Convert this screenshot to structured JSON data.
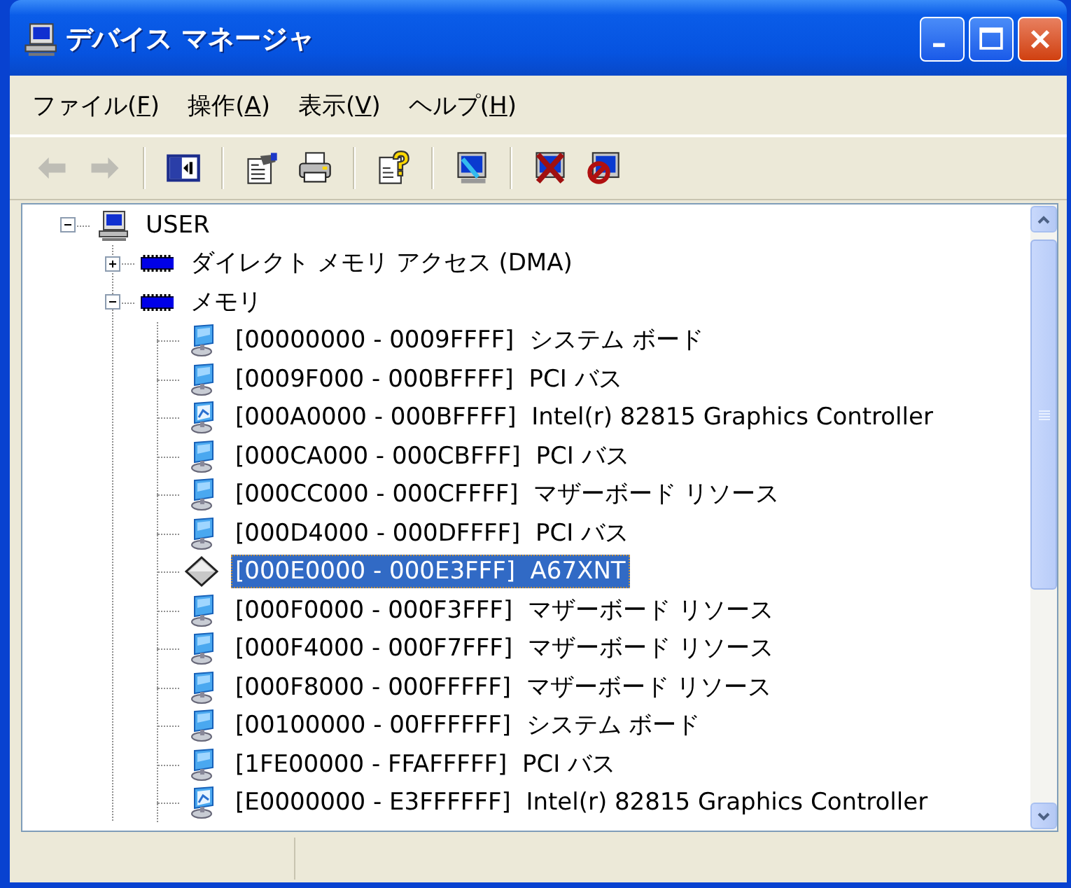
{
  "window": {
    "title": "デバイス マネージャ"
  },
  "title_buttons": [
    {
      "kind": "minimize"
    },
    {
      "kind": "maximize"
    },
    {
      "kind": "close"
    }
  ],
  "menu": [
    {
      "label": "ファイル(F)"
    },
    {
      "label": "操作(A)"
    },
    {
      "label": "表示(V)"
    },
    {
      "label": "ヘルプ(H)"
    }
  ],
  "toolbar": [
    {
      "kind": "back",
      "disabled": true
    },
    {
      "kind": "forward",
      "disabled": true
    },
    {
      "kind": "separator"
    },
    {
      "kind": "tree",
      "disabled": false
    },
    {
      "kind": "separator"
    },
    {
      "kind": "properties",
      "disabled": false
    },
    {
      "kind": "print",
      "disabled": false
    },
    {
      "kind": "separator"
    },
    {
      "kind": "help",
      "disabled": false
    },
    {
      "kind": "separator"
    },
    {
      "kind": "scan",
      "disabled": false
    },
    {
      "kind": "separator"
    },
    {
      "kind": "uninstall",
      "disabled": false
    },
    {
      "kind": "disable",
      "disabled": false
    }
  ],
  "tree": {
    "root": {
      "label": "USER",
      "kind": "computer",
      "expanded": true,
      "selected": false,
      "children": [
        {
          "label": "ダイレクト メモリ アクセス (DMA)",
          "kind": "chip",
          "expanded": false,
          "selected": false
        },
        {
          "label": "メモリ",
          "kind": "chip",
          "expanded": true,
          "selected": false,
          "children": [
            {
              "label": "[00000000 - 0009FFFF]  システム ボード",
              "kind": "device",
              "selected": false
            },
            {
              "label": "[0009F000 - 000BFFFF]  PCI バス",
              "kind": "device",
              "selected": false
            },
            {
              "label": "[000A0000 - 000BFFFF]  Intel(r) 82815 Graphics Controller",
              "kind": "display",
              "selected": false
            },
            {
              "label": "[000CA000 - 000CBFFF]  PCI バス",
              "kind": "device",
              "selected": false
            },
            {
              "label": "[000CC000 - 000CFFFF]  マザーボード リソース",
              "kind": "device",
              "selected": false
            },
            {
              "label": "[000D4000 - 000DFFFF]  PCI バス",
              "kind": "device",
              "selected": false
            },
            {
              "label": "[000E0000 - 000E3FFF]  A67XNT",
              "kind": "unknown",
              "selected": true
            },
            {
              "label": "[000F0000 - 000F3FFF]  マザーボード リソース",
              "kind": "device",
              "selected": false
            },
            {
              "label": "[000F4000 - 000F7FFF]  マザーボード リソース",
              "kind": "device",
              "selected": false
            },
            {
              "label": "[000F8000 - 000FFFFF]  マザーボード リソース",
              "kind": "device",
              "selected": false
            },
            {
              "label": "[00100000 - 00FFFFFF]  システム ボード",
              "kind": "device",
              "selected": false
            },
            {
              "label": "[1FE00000 - FFAFFFFF]  PCI バス",
              "kind": "device",
              "selected": false
            },
            {
              "label": "[E0000000 - E3FFFFFF]  Intel(r) 82815 Graphics Controller",
              "kind": "display",
              "selected": false
            }
          ]
        }
      ]
    }
  }
}
